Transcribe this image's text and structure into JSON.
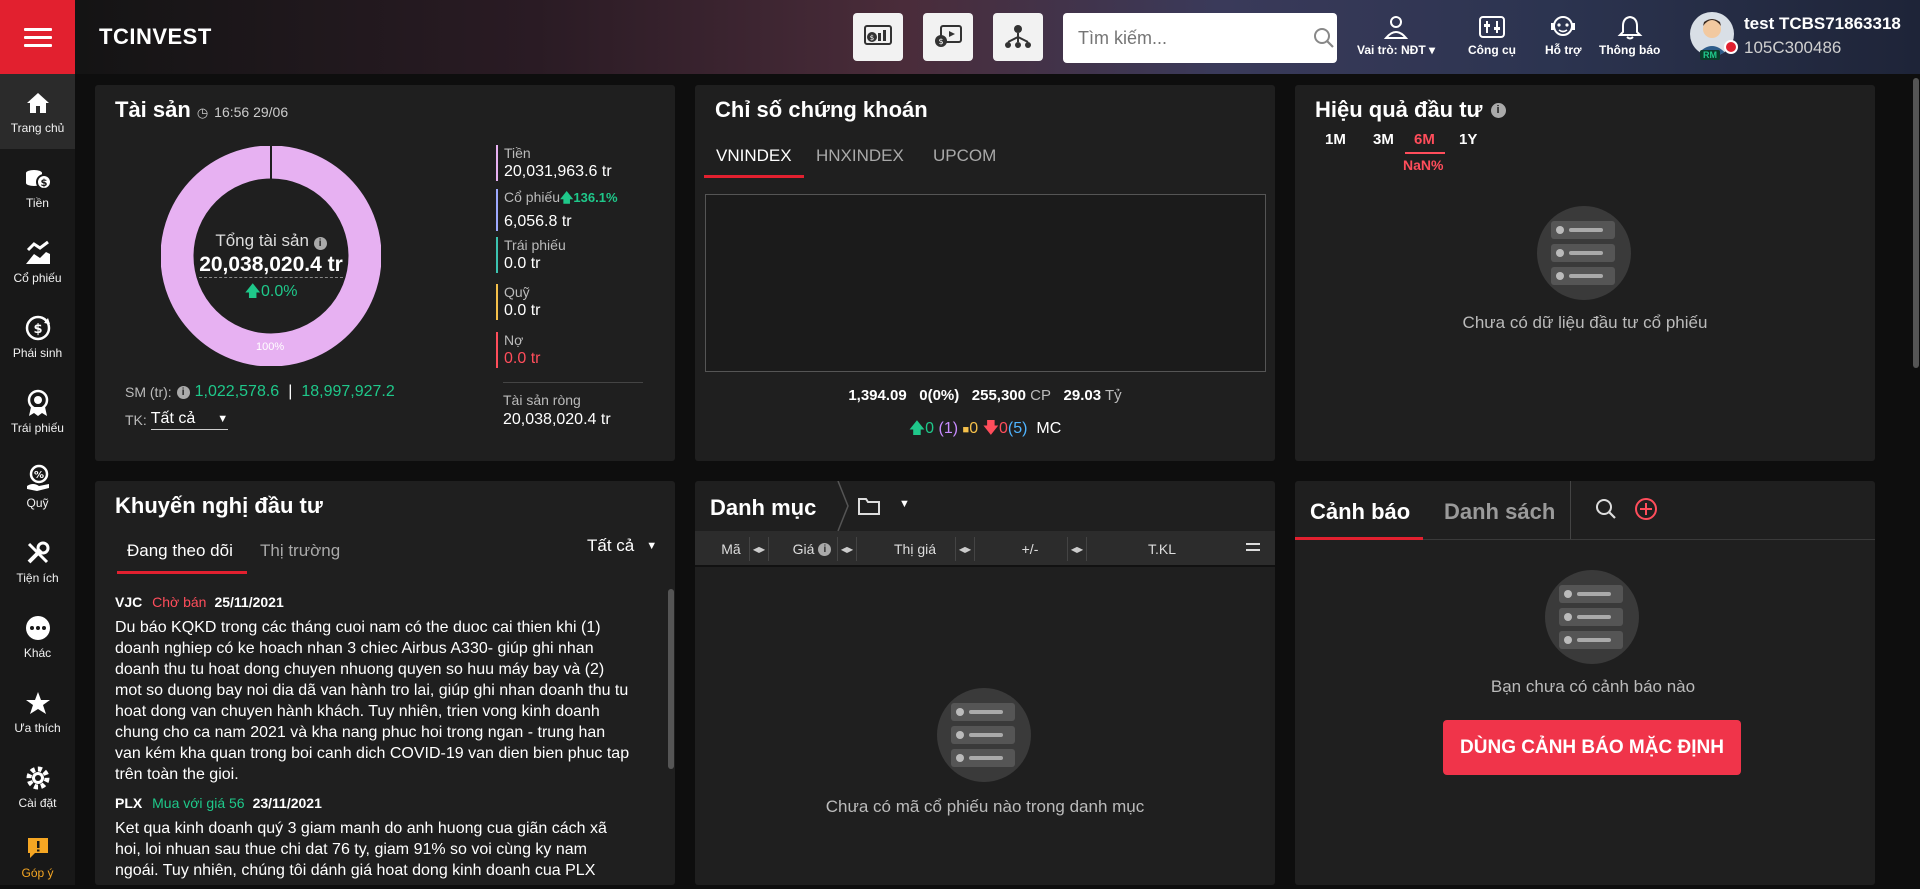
{
  "sidebar": {
    "items": [
      {
        "label": "Trang chủ",
        "icon": "home-icon"
      },
      {
        "label": "Tiền",
        "icon": "coins-icon"
      },
      {
        "label": "Cổ phiếu",
        "icon": "stock-icon"
      },
      {
        "label": "Phái sinh",
        "icon": "derivative-icon"
      },
      {
        "label": "Trái phiếu",
        "icon": "bond-icon"
      },
      {
        "label": "Quỹ",
        "icon": "fund-icon"
      },
      {
        "label": "Tiện ích",
        "icon": "tools-icon"
      },
      {
        "label": "Khác",
        "icon": "more-icon"
      },
      {
        "label": "Ưa thích",
        "icon": "star-icon"
      },
      {
        "label": "Cài đặt",
        "icon": "gear-icon"
      },
      {
        "label": "Góp ý",
        "icon": "feedback-icon"
      }
    ]
  },
  "header": {
    "logo": "TCINVEST",
    "search_placeholder": "Tìm kiếm...",
    "tools": {
      "role": "Vai trò: NĐT",
      "tools": "Công cụ",
      "support": "Hỗ trợ",
      "notifications": "Thông báo"
    },
    "user": {
      "name": "test TCBS71863318",
      "account": "105C300486",
      "badge": "RM"
    }
  },
  "assets": {
    "title": "Tài sản",
    "timestamp": "16:56 29/06",
    "donut_center_label": "Tổng tài sản",
    "total": "20,038,020.4 tr",
    "change": "0.0%",
    "slice_percent": "100%",
    "slice_fraction": 1.0,
    "donut_color": "#e7b1f2",
    "legend": [
      {
        "name": "Tiền",
        "value": "20,031,963.6 tr",
        "color": "#e7b1f2"
      },
      {
        "name": "Cổ phiếu",
        "value": "6,056.8 tr",
        "change": "136.1%",
        "color": "#9ea9ff"
      },
      {
        "name": "Trái phiếu",
        "value": "0.0 tr",
        "color": "#3cc3b0"
      },
      {
        "name": "Quỹ",
        "value": "0.0 tr",
        "color": "#f5c04a"
      },
      {
        "name": "Nợ",
        "value": "0.0 tr",
        "color": "#ff4d5b"
      }
    ],
    "net_label": "Tài sản ròng",
    "net_value": "20,038,020.4 tr",
    "sm_label": "SM (tr):",
    "sm_value1": "1,022,578.6",
    "sm_sep": "|",
    "sm_value2": "18,997,927.2",
    "tk_label": "TK:",
    "tk_value": "Tất cả"
  },
  "index": {
    "title": "Chỉ số chứng khoán",
    "tabs": [
      "VNINDEX",
      "HNXINDEX",
      "UPCOM"
    ],
    "stats": {
      "value": "1,394.09",
      "change": "0(0%)",
      "volume": "255,300",
      "volume_unit": "CP",
      "turnover": "29.03",
      "turnover_unit": "Tỷ"
    },
    "breadth": {
      "up": "0",
      "ceil": "(1)",
      "flat": "0",
      "down": "0",
      "floor": "(5)",
      "unit": "MC"
    }
  },
  "performance": {
    "title": "Hiệu quả đầu tư",
    "tabs": [
      "1M",
      "3M",
      "6M",
      "1Y"
    ],
    "active_value": "NaN%",
    "empty_text": "Chưa có dữ liệu đầu tư cổ phiếu"
  },
  "recommend": {
    "title": "Khuyến nghị đầu tư",
    "tabs": [
      "Đang theo dõi",
      "Thị trường"
    ],
    "filter": "Tất cả",
    "items": [
      {
        "ticker": "VJC",
        "action": "Chờ bán",
        "date": "25/11/2021",
        "text": "Du báo KQKD trong các tháng cuoi nam có the duoc cai thien khi (1) doanh nghiep có ke hoach nhan 3 chiec Airbus A330- giúp ghi nhan doanh thu tu hoat dong chuyen nhuong quyen so huu máy bay và (2) mot so duong bay noi dia dã van hành tro lai, giúp ghi nhan doanh thu tu hoat dong van chuyen hành khách. Tuy nhiên, trien vong kinh doanh chung cho ca nam 2021 và kha nang phuc hoi trong ngan - trung han van kém kha quan trong boi canh dich COVID-19 van dien bien phuc tap trên toàn the gioi."
      },
      {
        "ticker": "PLX",
        "action": "Mua với giá 56",
        "date": "23/11/2021",
        "text": "Ket qua kinh doanh quý 3 giam manh do anh huong cua giãn cách xã hoi, loi nhuan sau thue chi dat 76 ty, giam 91% so voi cùng ky nam ngoái. Tuy nhiên, chúng tôi dánh giá hoat dong kinh doanh cua PLX"
      }
    ]
  },
  "portfolio": {
    "title": "Danh mục",
    "columns": [
      "Mã",
      "Giá",
      "Thị giá",
      "+/-",
      "T.KL"
    ],
    "empty_text": "Chưa có mã cổ phiếu nào trong danh mục"
  },
  "alerts": {
    "tabs": [
      "Cảnh báo",
      "Danh sách"
    ],
    "empty_text": "Bạn chưa có cảnh báo nào",
    "default_button": "DÙNG CẢNH BÁO MẶC ĐỊNH"
  },
  "colors": {
    "accent": "#e2202f",
    "green": "#1fc88a",
    "red": "#ff4d5b",
    "panel": "#1f1f1f"
  }
}
